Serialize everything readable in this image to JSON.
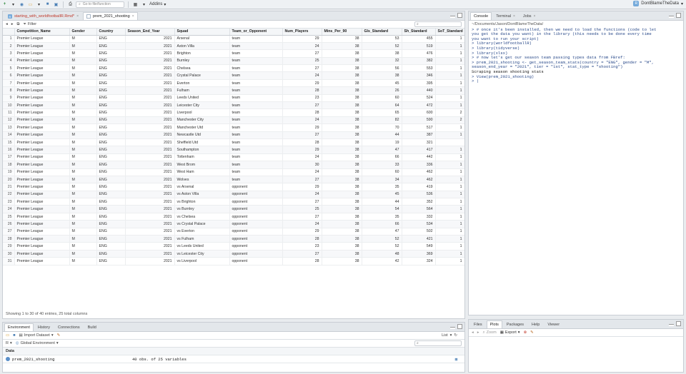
{
  "toolbar": {
    "goto_placeholder": "Go to file/function",
    "addins_label": "Addins",
    "project_name": "DontBlameTheData"
  },
  "source_pane": {
    "tabs": [
      {
        "label": "starting_with_worldfootballR.Rmd*",
        "modified": true
      },
      {
        "label": "prem_2021_shooting",
        "active": true
      }
    ],
    "filter_label": "Filter",
    "columns": [
      "Competition_Name",
      "Gender",
      "Country",
      "Season_End_Year",
      "Squad",
      "Team_or_Opponent",
      "Num_Players",
      "Mins_Per_90",
      "Gls_Standard",
      "Sh_Standard",
      "SoT_Standard"
    ],
    "rows": [
      [
        "1",
        "Premier League",
        "M",
        "ENG",
        "2021",
        "Arsenal",
        "team",
        "29",
        "38",
        "53",
        "455",
        "1"
      ],
      [
        "2",
        "Premier League",
        "M",
        "ENG",
        "2021",
        "Aston Villa",
        "team",
        "24",
        "38",
        "52",
        "519",
        "1"
      ],
      [
        "3",
        "Premier League",
        "M",
        "ENG",
        "2021",
        "Brighton",
        "team",
        "27",
        "38",
        "38",
        "476",
        "1"
      ],
      [
        "4",
        "Premier League",
        "M",
        "ENG",
        "2021",
        "Burnley",
        "team",
        "25",
        "38",
        "32",
        "382",
        "1"
      ],
      [
        "5",
        "Premier League",
        "M",
        "ENG",
        "2021",
        "Chelsea",
        "team",
        "27",
        "38",
        "56",
        "553",
        "1"
      ],
      [
        "6",
        "Premier League",
        "M",
        "ENG",
        "2021",
        "Crystal Palace",
        "team",
        "24",
        "38",
        "38",
        "346",
        "1"
      ],
      [
        "7",
        "Premier League",
        "M",
        "ENG",
        "2021",
        "Everton",
        "team",
        "29",
        "38",
        "45",
        "395",
        "1"
      ],
      [
        "8",
        "Premier League",
        "M",
        "ENG",
        "2021",
        "Fulham",
        "team",
        "28",
        "38",
        "26",
        "440",
        "1"
      ],
      [
        "9",
        "Premier League",
        "M",
        "ENG",
        "2021",
        "Leeds United",
        "team",
        "23",
        "38",
        "60",
        "524",
        "1"
      ],
      [
        "10",
        "Premier League",
        "M",
        "ENG",
        "2021",
        "Leicester City",
        "team",
        "27",
        "38",
        "64",
        "472",
        "1"
      ],
      [
        "11",
        "Premier League",
        "M",
        "ENG",
        "2021",
        "Liverpool",
        "team",
        "28",
        "38",
        "65",
        "600",
        "2"
      ],
      [
        "12",
        "Premier League",
        "M",
        "ENG",
        "2021",
        "Manchester City",
        "team",
        "24",
        "38",
        "82",
        "590",
        "2"
      ],
      [
        "13",
        "Premier League",
        "M",
        "ENG",
        "2021",
        "Manchester Utd",
        "team",
        "29",
        "38",
        "70",
        "517",
        "1"
      ],
      [
        "14",
        "Premier League",
        "M",
        "ENG",
        "2021",
        "Newcastle Utd",
        "team",
        "27",
        "38",
        "44",
        "387",
        "1"
      ],
      [
        "15",
        "Premier League",
        "M",
        "ENG",
        "2021",
        "Sheffield Utd",
        "team",
        "28",
        "38",
        "19",
        "321",
        ""
      ],
      [
        "16",
        "Premier League",
        "M",
        "ENG",
        "2021",
        "Southampton",
        "team",
        "29",
        "38",
        "47",
        "417",
        "1"
      ],
      [
        "17",
        "Premier League",
        "M",
        "ENG",
        "2021",
        "Tottenham",
        "team",
        "24",
        "38",
        "66",
        "442",
        "1"
      ],
      [
        "18",
        "Premier League",
        "M",
        "ENG",
        "2021",
        "West Brom",
        "team",
        "30",
        "38",
        "33",
        "336",
        "1"
      ],
      [
        "19",
        "Premier League",
        "M",
        "ENG",
        "2021",
        "West Ham",
        "team",
        "24",
        "38",
        "60",
        "462",
        "1"
      ],
      [
        "20",
        "Premier League",
        "M",
        "ENG",
        "2021",
        "Wolves",
        "team",
        "27",
        "38",
        "34",
        "462",
        "1"
      ],
      [
        "21",
        "Premier League",
        "M",
        "ENG",
        "2021",
        "vs Arsenal",
        "opponent",
        "29",
        "38",
        "35",
        "419",
        "1"
      ],
      [
        "22",
        "Premier League",
        "M",
        "ENG",
        "2021",
        "vs Aston Villa",
        "opponent",
        "24",
        "38",
        "45",
        "536",
        "1"
      ],
      [
        "23",
        "Premier League",
        "M",
        "ENG",
        "2021",
        "vs Brighton",
        "opponent",
        "27",
        "38",
        "44",
        "352",
        "1"
      ],
      [
        "24",
        "Premier League",
        "M",
        "ENG",
        "2021",
        "vs Burnley",
        "opponent",
        "25",
        "38",
        "54",
        "564",
        "1"
      ],
      [
        "25",
        "Premier League",
        "M",
        "ENG",
        "2021",
        "vs Chelsea",
        "opponent",
        "27",
        "38",
        "35",
        "332",
        "1"
      ],
      [
        "26",
        "Premier League",
        "M",
        "ENG",
        "2021",
        "vs Crystal Palace",
        "opponent",
        "24",
        "38",
        "66",
        "534",
        "1"
      ],
      [
        "27",
        "Premier League",
        "M",
        "ENG",
        "2021",
        "vs Everton",
        "opponent",
        "29",
        "38",
        "47",
        "502",
        "1"
      ],
      [
        "28",
        "Premier League",
        "M",
        "ENG",
        "2021",
        "vs Fulham",
        "opponent",
        "28",
        "38",
        "52",
        "421",
        "1"
      ],
      [
        "29",
        "Premier League",
        "M",
        "ENG",
        "2021",
        "vs Leeds United",
        "opponent",
        "23",
        "38",
        "52",
        "549",
        "1"
      ],
      [
        "30",
        "Premier League",
        "M",
        "ENG",
        "2021",
        "vs Leicester City",
        "opponent",
        "27",
        "38",
        "48",
        "369",
        "1"
      ],
      [
        "31",
        "Premier League",
        "M",
        "ENG",
        "2021",
        "vs Liverpool",
        "opponent",
        "28",
        "38",
        "42",
        "324",
        "1"
      ]
    ],
    "status": "Showing 1 to 30 of 40 entries, 25 total columns"
  },
  "console_pane": {
    "tabs": [
      "Console",
      "Terminal",
      "Jobs"
    ],
    "path": "~/Documents/Jason/DontBlameTheData/",
    "lines": [
      {
        "text": "> # once it's been installed, then we need to load the functions (code to let",
        "kind": "cmd"
      },
      {
        "text": "  you get the data you want) in the library (this needs to be done every time",
        "kind": "cmd"
      },
      {
        "text": "  you want to run your script)",
        "kind": "cmd"
      },
      {
        "text": "> library(worldfootballR)",
        "kind": "cmd"
      },
      {
        "text": "> library(tidyverse)",
        "kind": "cmd"
      },
      {
        "text": "> library(xlsx)",
        "kind": "cmd"
      },
      {
        "text": "> # now let's get our season team passing types data from FBref:",
        "kind": "cmd"
      },
      {
        "text": "> prem_2021_shooting <- get_season_team_stats(country = \"ENG\", gender = \"M\",",
        "kind": "cmd"
      },
      {
        "text": "  season_end_year = \"2021\", tier = \"1st\", stat_type = \"shooting\")",
        "kind": "cmd"
      },
      {
        "text": "Scraping season shooting stats",
        "kind": "out"
      },
      {
        "text": "> View(prem_2021_shooting)",
        "kind": "cmd"
      },
      {
        "text": "> |",
        "kind": "cmd"
      }
    ]
  },
  "env_pane": {
    "tabs": [
      "Environment",
      "History",
      "Connections",
      "Build"
    ],
    "import_label": "Import Dataset",
    "list_label": "List",
    "lang": "R",
    "scope_label": "Global Environment",
    "data_header": "Data",
    "items": [
      {
        "name": "prem_2021_shooting",
        "value": "40 obs. of 25 variables"
      }
    ]
  },
  "files_pane": {
    "tabs": [
      "Files",
      "Plots",
      "Packages",
      "Help",
      "Viewer"
    ],
    "zoom_label": "Zoom",
    "export_label": "Export"
  }
}
